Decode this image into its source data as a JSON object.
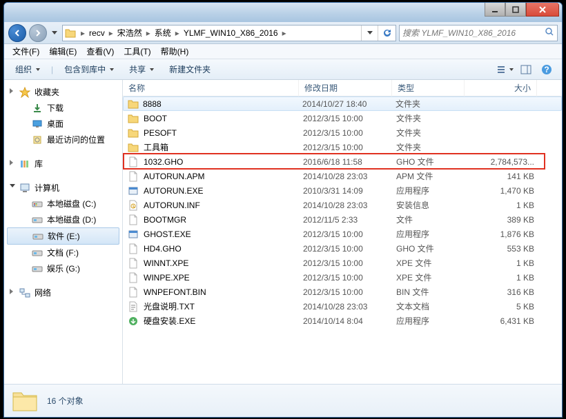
{
  "titlebar": {},
  "address": {
    "crumbs": [
      "recv",
      "宋浩然",
      "系统",
      "YLMF_WIN10_X86_2016"
    ],
    "search_placeholder": "搜索 YLMF_WIN10_X86_2016"
  },
  "menubar": [
    "文件(F)",
    "编辑(E)",
    "查看(V)",
    "工具(T)",
    "帮助(H)"
  ],
  "toolbar": {
    "organize": "组织",
    "include": "包含到库中",
    "share": "共享",
    "newfolder": "新建文件夹"
  },
  "sidebar": {
    "favorites": {
      "label": "收藏夹",
      "items": [
        "下载",
        "桌面",
        "最近访问的位置"
      ]
    },
    "libraries": {
      "label": "库"
    },
    "computer": {
      "label": "计算机",
      "items": [
        "本地磁盘 (C:)",
        "本地磁盘 (D:)",
        "软件 (E:)",
        "文档 (F:)",
        "娱乐 (G:)"
      ]
    },
    "network": {
      "label": "网络"
    }
  },
  "columns": {
    "name": "名称",
    "date": "修改日期",
    "type": "类型",
    "size": "大小"
  },
  "files": [
    {
      "icon": "folder",
      "name": "8888",
      "date": "2014/10/27 18:40",
      "type": "文件夹",
      "size": ""
    },
    {
      "icon": "folder",
      "name": "BOOT",
      "date": "2012/3/15 10:00",
      "type": "文件夹",
      "size": ""
    },
    {
      "icon": "folder",
      "name": "PESOFT",
      "date": "2012/3/15 10:00",
      "type": "文件夹",
      "size": ""
    },
    {
      "icon": "folder",
      "name": "工具箱",
      "date": "2012/3/15 10:00",
      "type": "文件夹",
      "size": ""
    },
    {
      "icon": "file",
      "name": "1032.GHO",
      "date": "2016/6/18 11:58",
      "type": "GHO 文件",
      "size": "2,784,573..."
    },
    {
      "icon": "file",
      "name": "AUTORUN.APM",
      "date": "2014/10/28 23:03",
      "type": "APM 文件",
      "size": "141 KB"
    },
    {
      "icon": "exe",
      "name": "AUTORUN.EXE",
      "date": "2010/3/31 14:09",
      "type": "应用程序",
      "size": "1,470 KB"
    },
    {
      "icon": "inf",
      "name": "AUTORUN.INF",
      "date": "2014/10/28 23:03",
      "type": "安装信息",
      "size": "1 KB"
    },
    {
      "icon": "file",
      "name": "BOOTMGR",
      "date": "2012/11/5 2:33",
      "type": "文件",
      "size": "389 KB"
    },
    {
      "icon": "exe",
      "name": "GHOST.EXE",
      "date": "2012/3/15 10:00",
      "type": "应用程序",
      "size": "1,876 KB"
    },
    {
      "icon": "file",
      "name": "HD4.GHO",
      "date": "2012/3/15 10:00",
      "type": "GHO 文件",
      "size": "553 KB"
    },
    {
      "icon": "file",
      "name": "WINNT.XPE",
      "date": "2012/3/15 10:00",
      "type": "XPE 文件",
      "size": "1 KB"
    },
    {
      "icon": "file",
      "name": "WINPE.XPE",
      "date": "2012/3/15 10:00",
      "type": "XPE 文件",
      "size": "1 KB"
    },
    {
      "icon": "file",
      "name": "WNPEFONT.BIN",
      "date": "2012/3/15 10:00",
      "type": "BIN 文件",
      "size": "316 KB"
    },
    {
      "icon": "txt",
      "name": "光盘说明.TXT",
      "date": "2014/10/28 23:03",
      "type": "文本文档",
      "size": "5 KB"
    },
    {
      "icon": "setup",
      "name": "硬盘安装.EXE",
      "date": "2014/10/14 8:04",
      "type": "应用程序",
      "size": "6,431 KB"
    }
  ],
  "highlighted_row_index": 4,
  "hover_row_index": 0,
  "selected_drive_index": 2,
  "status": {
    "count_label": "16 个对象"
  }
}
